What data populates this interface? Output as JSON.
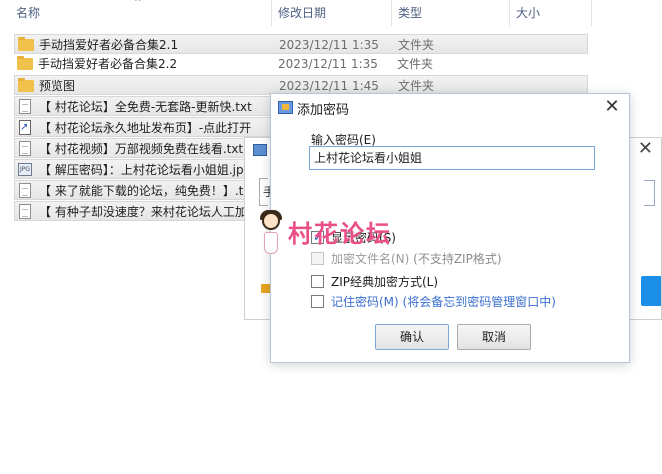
{
  "header": {
    "columns": [
      "名称",
      "修改日期",
      "类型",
      "大小"
    ]
  },
  "files": [
    {
      "name": "手动挡爱好者必备合集2.1",
      "date": "2023/12/11 1:35",
      "type": "文件夹",
      "icon": "folder-icon"
    },
    {
      "name": "手动挡爱好者必备合集2.2",
      "date": "2023/12/11 1:35",
      "type": "文件夹",
      "icon": "folder-icon"
    },
    {
      "name": "预览图",
      "date": "2023/12/11 1:45",
      "type": "文件夹",
      "icon": "folder-icon"
    },
    {
      "name": "【 村花论坛】全免费-无套路-更新快.txt",
      "icon": "text-file-icon"
    },
    {
      "name": "【 村花论坛永久地址发布页】-点此打开",
      "icon": "url-shortcut-icon"
    },
    {
      "name": "【 村花视频】万部视频免费在线看.txt",
      "icon": "text-file-icon"
    },
    {
      "name": "【 解压密码】：上村花论坛看小姐姐.jp",
      "icon": "image-file-icon"
    },
    {
      "name": "【 来了就能下载的论坛，纯免费！】.t",
      "icon": "text-file-icon"
    },
    {
      "name": "【 有种子却没速度？来村花论坛人工加",
      "icon": "text-file-icon"
    }
  ],
  "bg_dialog": {
    "field_text": "手"
  },
  "dialog": {
    "title": "添加密码",
    "close": "✕",
    "password_label": "输入密码(E)",
    "password_value": "上村花论坛看小姐姐",
    "options": {
      "show_password": "显示密码(S)",
      "encrypt_filenames": "加密文件名(N)",
      "encrypt_filenames_note": " (不支持ZIP格式)",
      "zip_classic": "ZIP经典加密方式(L)",
      "remember_password": "记住密码(M)",
      "remember_password_note": " (将会备忘到密码管理窗口中)"
    },
    "ok": "确认",
    "cancel": "取消"
  },
  "watermark": {
    "text": "村花论坛"
  },
  "colors": {
    "accent": "#1c8fe9",
    "link": "#3a6fcf",
    "watermark": "#ea4f87",
    "folder": "#f1c24b"
  }
}
